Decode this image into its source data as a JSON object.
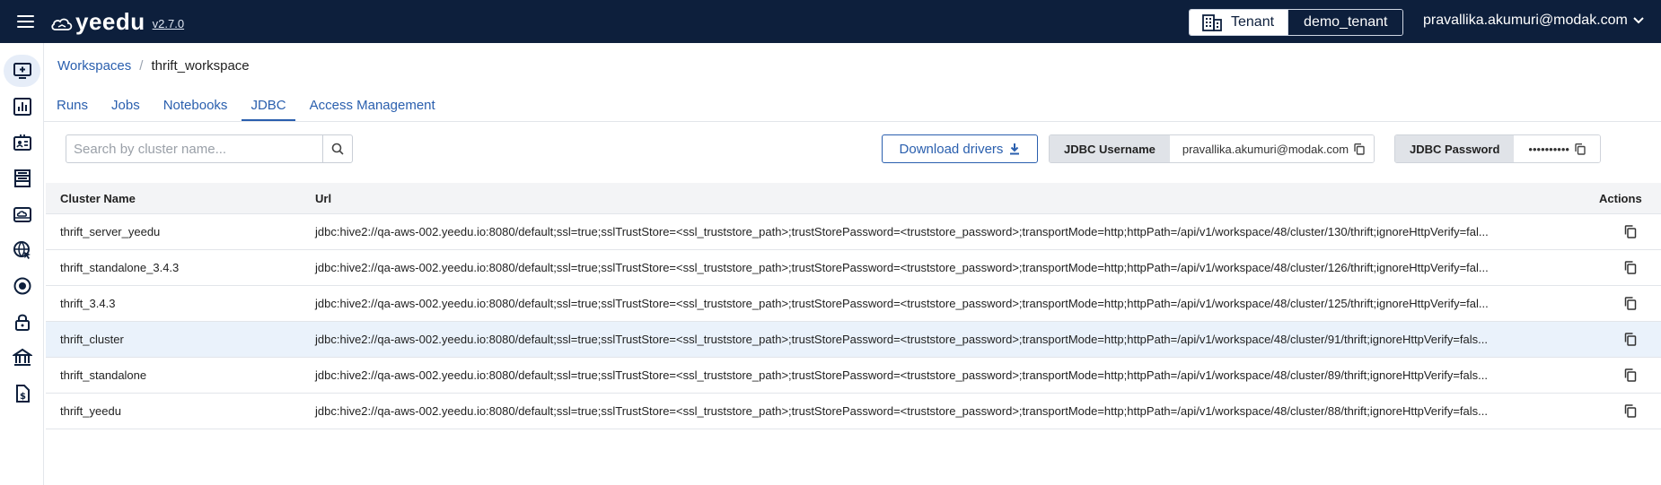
{
  "app": {
    "brand": "yeedu",
    "version": "v2.7.0"
  },
  "header": {
    "tenant_label": "Tenant",
    "tenant_value": "demo_tenant",
    "user_email": "pravallika.akumuri@modak.com"
  },
  "sidebar": {
    "items": [
      {
        "icon": "workspace-monitor-icon",
        "active": true
      },
      {
        "icon": "bar-chart-icon",
        "active": false
      },
      {
        "icon": "id-card-icon",
        "active": false
      },
      {
        "icon": "server-rack-icon",
        "active": false
      },
      {
        "icon": "cloud-drive-icon",
        "active": false
      },
      {
        "icon": "globe-cursor-icon",
        "active": false
      },
      {
        "icon": "target-icon",
        "active": false
      },
      {
        "icon": "lock-icon",
        "active": false
      },
      {
        "icon": "bank-icon",
        "active": false
      },
      {
        "icon": "billing-doc-icon",
        "active": false
      }
    ]
  },
  "breadcrumb": {
    "parent": "Workspaces",
    "separator": "/",
    "current": "thrift_workspace"
  },
  "tabs": [
    {
      "label": "Runs",
      "active": false
    },
    {
      "label": "Jobs",
      "active": false
    },
    {
      "label": "Notebooks",
      "active": false
    },
    {
      "label": "JDBC",
      "active": true
    },
    {
      "label": "Access Management",
      "active": false
    }
  ],
  "search": {
    "placeholder": "Search by cluster name...",
    "value": ""
  },
  "download_button": "Download drivers",
  "jdbc_username": {
    "label": "JDBC Username",
    "value": "pravallika.akumuri@modak.com"
  },
  "jdbc_password": {
    "label": "JDBC Password",
    "value": "••••••••••"
  },
  "table": {
    "columns": [
      "Cluster Name",
      "Url",
      "Actions"
    ],
    "rows": [
      {
        "name": "thrift_server_yeedu",
        "url": "jdbc:hive2://qa-aws-002.yeedu.io:8080/default;ssl=true;sslTrustStore=<ssl_truststore_path>;trustStorePassword=<truststore_password>;transportMode=http;httpPath=/api/v1/workspace/48/cluster/130/thrift;ignoreHttpVerify=fal..."
      },
      {
        "name": "thrift_standalone_3.4.3",
        "url": "jdbc:hive2://qa-aws-002.yeedu.io:8080/default;ssl=true;sslTrustStore=<ssl_truststore_path>;trustStorePassword=<truststore_password>;transportMode=http;httpPath=/api/v1/workspace/48/cluster/126/thrift;ignoreHttpVerify=fal..."
      },
      {
        "name": "thrift_3.4.3",
        "url": "jdbc:hive2://qa-aws-002.yeedu.io:8080/default;ssl=true;sslTrustStore=<ssl_truststore_path>;trustStorePassword=<truststore_password>;transportMode=http;httpPath=/api/v1/workspace/48/cluster/125/thrift;ignoreHttpVerify=fal..."
      },
      {
        "name": "thrift_cluster",
        "url": "jdbc:hive2://qa-aws-002.yeedu.io:8080/default;ssl=true;sslTrustStore=<ssl_truststore_path>;trustStorePassword=<truststore_password>;transportMode=http;httpPath=/api/v1/workspace/48/cluster/91/thrift;ignoreHttpVerify=fals...",
        "highlight": true
      },
      {
        "name": "thrift_standalone",
        "url": "jdbc:hive2://qa-aws-002.yeedu.io:8080/default;ssl=true;sslTrustStore=<ssl_truststore_path>;trustStorePassword=<truststore_password>;transportMode=http;httpPath=/api/v1/workspace/48/cluster/89/thrift;ignoreHttpVerify=fals..."
      },
      {
        "name": "thrift_yeedu",
        "url": "jdbc:hive2://qa-aws-002.yeedu.io:8080/default;ssl=true;sslTrustStore=<ssl_truststore_path>;trustStorePassword=<truststore_password>;transportMode=http;httpPath=/api/v1/workspace/48/cluster/88/thrift;ignoreHttpVerify=fals..."
      }
    ]
  },
  "colors": {
    "topbar": "#0d1f3c",
    "link": "#2a5fae",
    "row_highlight": "#eaf2fb"
  }
}
